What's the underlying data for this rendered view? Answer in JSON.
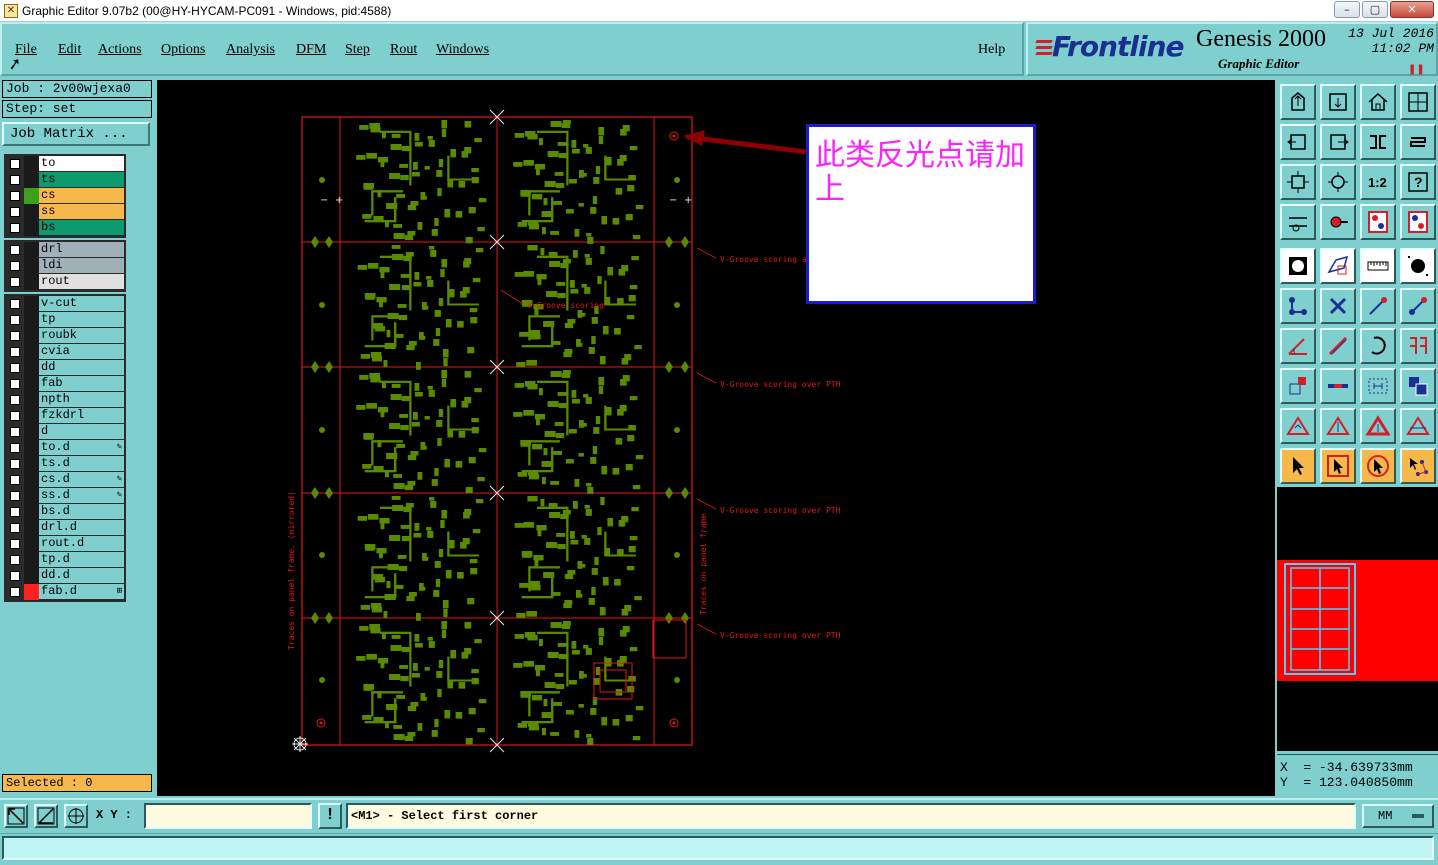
{
  "window": {
    "title": "Graphic Editor 9.07b2 (00@HY-HYCAM-PC091 - Windows, pid:4588)",
    "controls": [
      "minimize",
      "maximize",
      "close"
    ]
  },
  "menu": {
    "items": [
      "File",
      "Edit",
      "Actions",
      "Options",
      "Analysis",
      "DFM",
      "Step",
      "Rout",
      "Windows"
    ],
    "help": "Help"
  },
  "logo": {
    "brand": "Frontline",
    "product": "Genesis 2000",
    "subtitle": "Graphic Editor",
    "date": "13 Jul 2016",
    "time": "11:02 PM"
  },
  "job": {
    "job_label": "Job : 2v00wjexa0",
    "step_label": "Step: set",
    "job_matrix_button": "Job Matrix ..."
  },
  "layers": {
    "group1": [
      {
        "name": "to",
        "color": "#ffffff",
        "swatch": "#1a1a1a"
      },
      {
        "name": "ts",
        "color": "#0e9a6e",
        "swatch": "#1a1a1a"
      },
      {
        "name": "cs",
        "color": "#f6b84a",
        "swatch": "#3aa020"
      },
      {
        "name": "ss",
        "color": "#f6b84a",
        "swatch": "#1a1a1a"
      },
      {
        "name": "bs",
        "color": "#0e9a6e",
        "swatch": "#1a1a1a"
      }
    ],
    "group2": [
      {
        "name": "drl",
        "color": "#a0b0b8",
        "swatch": "#1a1a1a"
      },
      {
        "name": "ldi",
        "color": "#a0b0b8",
        "swatch": "#1a1a1a"
      },
      {
        "name": "rout",
        "color": "#e0e0e0",
        "swatch": "#1a1a1a"
      }
    ],
    "group3": [
      {
        "name": "v-cut",
        "color": "#7fcfcf",
        "swatch": "#1a1a1a",
        "mark": ""
      },
      {
        "name": "tp",
        "color": "#7fcfcf",
        "swatch": "#1a1a1a",
        "mark": ""
      },
      {
        "name": "roubk",
        "color": "#7fcfcf",
        "swatch": "#1a1a1a",
        "mark": ""
      },
      {
        "name": "cvia",
        "color": "#7fcfcf",
        "swatch": "#1a1a1a",
        "mark": ""
      },
      {
        "name": "dd",
        "color": "#7fcfcf",
        "swatch": "#1a1a1a",
        "mark": ""
      },
      {
        "name": "fab",
        "color": "#7fcfcf",
        "swatch": "#1a1a1a",
        "mark": ""
      },
      {
        "name": "npth",
        "color": "#7fcfcf",
        "swatch": "#1a1a1a",
        "mark": ""
      },
      {
        "name": "fzkdrl",
        "color": "#7fcfcf",
        "swatch": "#1a1a1a",
        "mark": ""
      },
      {
        "name": "d",
        "color": "#7fcfcf",
        "swatch": "#1a1a1a",
        "mark": ""
      },
      {
        "name": "to.d",
        "color": "#7fcfcf",
        "swatch": "#1a1a1a",
        "mark": "✎"
      },
      {
        "name": "ts.d",
        "color": "#7fcfcf",
        "swatch": "#1a1a1a",
        "mark": ""
      },
      {
        "name": "cs.d",
        "color": "#7fcfcf",
        "swatch": "#1a1a1a",
        "mark": "✎"
      },
      {
        "name": "ss.d",
        "color": "#7fcfcf",
        "swatch": "#1a1a1a",
        "mark": "✎"
      },
      {
        "name": "bs.d",
        "color": "#7fcfcf",
        "swatch": "#1a1a1a",
        "mark": ""
      },
      {
        "name": "drl.d",
        "color": "#7fcfcf",
        "swatch": "#1a1a1a",
        "mark": ""
      },
      {
        "name": "rout.d",
        "color": "#7fcfcf",
        "swatch": "#1a1a1a",
        "mark": ""
      },
      {
        "name": "tp.d",
        "color": "#7fcfcf",
        "swatch": "#1a1a1a",
        "mark": ""
      },
      {
        "name": "dd.d",
        "color": "#7fcfcf",
        "swatch": "#1a1a1a",
        "mark": ""
      },
      {
        "name": "fab.d",
        "color": "#7fcfcf",
        "swatch": "#ff2020",
        "mark": "⊞"
      }
    ]
  },
  "selected_label": "Selected : 0",
  "canvas": {
    "callout_text": "此类反光点请加上",
    "vgroove_labels": [
      "V-Groove scoring a",
      "V-Groove scoring",
      "V-Groove scoring over PTH",
      "V-Groove scoring over PTH",
      "V-Groove scoring over PTH"
    ],
    "left_frame_label": "Traces on panel frame. (mirrored)",
    "right_frame_label": "Traces on panel frame"
  },
  "toolbox": {
    "buttons": [
      "load-step-icon",
      "save-icon",
      "home-icon",
      "window-layout-icon",
      "zoom-out-icon",
      "zoom-in-icon",
      "zoom-reverse-icon",
      "redraw-icon",
      "fit-icon",
      "zoom-fit-icon",
      "ratio-1-2-icon",
      "help-icon",
      "measure-icon",
      "probe-icon",
      "traffic-light-icon",
      "traffic-light-2-icon",
      "select-icon",
      "polygon-icon",
      "ruler-icon",
      "pad-icon",
      "connect-icon",
      "cross-icon",
      "line-icon",
      "point-line-icon",
      "angle-icon",
      "diagonal-icon",
      "arc-icon",
      "flip-icon",
      "move-icon",
      "resize-icon",
      "frame-icon",
      "copy-icon",
      "triangle-icon",
      "triangle-2-icon",
      "triangle-3-icon",
      "triangle-4-icon",
      "pointer-icon",
      "pointer-box-icon",
      "pointer-circle-icon",
      "pointer-network-icon"
    ]
  },
  "coords": {
    "x": "X  = -34.639733mm",
    "y": "Y  = 123.040850mm"
  },
  "bottom": {
    "xy_label": "X Y :",
    "xy_value": "",
    "warn": "!",
    "status": "<M1> - Select first corner",
    "units": "MM"
  }
}
